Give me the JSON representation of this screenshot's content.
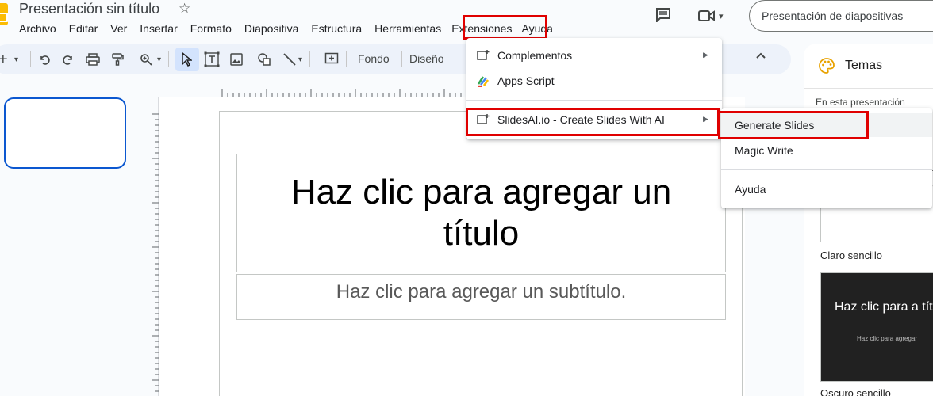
{
  "header": {
    "doc_title": "Presentación sin título",
    "slideshow_label": "Presentación de diapositivas"
  },
  "menubar": {
    "items": [
      "Archivo",
      "Editar",
      "Ver",
      "Insertar",
      "Formato",
      "Diapositiva",
      "Estructura",
      "Herramientas",
      "Extensiones",
      "Ayuda"
    ],
    "highlighted": "Extensiones"
  },
  "toolbar": {
    "fondo_label": "Fondo",
    "diseno_label": "Diseño"
  },
  "slide": {
    "title_placeholder": "Haz clic para agregar un título",
    "subtitle_placeholder": "Haz clic para agregar un subtítulo."
  },
  "extensions_menu": {
    "items": [
      {
        "label": "Complementos",
        "icon": "addon-icon",
        "has_submenu": true
      },
      {
        "label": "Apps Script",
        "icon": "apps-script-icon",
        "has_submenu": false
      },
      {
        "label": "SlidesAI.io - Create Slides With AI",
        "icon": "addon-icon",
        "has_submenu": true
      }
    ]
  },
  "submenu": {
    "items": [
      "Generate Slides",
      "Magic Write",
      "Ayuda"
    ],
    "hovered": "Generate Slides"
  },
  "themes_panel": {
    "title": "Temas",
    "section": "En esta presentación",
    "themes": [
      {
        "name": "Claro sencillo"
      },
      {
        "name": "Oscuro sencillo",
        "preview_title": "Haz clic para a título",
        "preview_subtitle": "Haz clic para agregar"
      }
    ],
    "clipped_text": [
      "a",
      "o"
    ]
  },
  "colors": {
    "highlight_red": "#e00000",
    "accent_blue": "#0b57d0",
    "toolbar_bg": "#edf2fa",
    "logo_yellow": "#fbbc04"
  }
}
